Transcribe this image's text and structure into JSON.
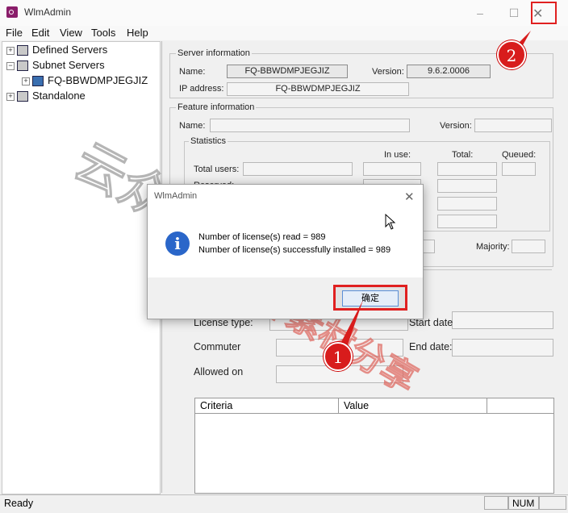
{
  "window": {
    "title": "WlmAdmin",
    "minimize_glyph": "–",
    "maximize_glyph": "☐",
    "close_glyph": "✕"
  },
  "menu": [
    "File",
    "Edit",
    "View",
    "Tools",
    "Help"
  ],
  "tree": {
    "defined_servers": "Defined Servers",
    "subnet_servers": "Subnet Servers",
    "server_node": "FQ-BBWDMPJEGJIZ",
    "standalone": "Standalone"
  },
  "server_info": {
    "group_label": "Server information",
    "name_label": "Name:",
    "name_value": "FQ-BBWDMPJEGJIZ",
    "version_label": "Version:",
    "version_value": "9.6.2.0006",
    "ip_label": "IP address:",
    "ip_value": "FQ-BBWDMPJEGJIZ"
  },
  "feature_info": {
    "group_label": "Feature information",
    "name_label": "Name:",
    "version_label": "Version:",
    "statistics_label": "Statistics",
    "in_use_label": "In use:",
    "total_label": "Total:",
    "queued_label": "Queued:",
    "total_users_label": "Total users:",
    "reserved_label": "Reserved:",
    "majority_label": "Majority:"
  },
  "license": {
    "license_type_label": "License type:",
    "start_date_label": "Start date",
    "commuter_label": "Commuter",
    "end_date_label": "End date:",
    "allowed_on_label": "Allowed on",
    "columns": [
      "Criteria",
      "Value"
    ]
  },
  "dialog": {
    "title": "WlmAdmin",
    "close_glyph": "✕",
    "info_glyph": "i",
    "line1": "Number of license(s) read = 989",
    "line2": "Number of license(s) successfully installed = 989",
    "ok_label": "确定"
  },
  "status": {
    "text": "Ready",
    "num": "NUM"
  },
  "annotations": {
    "step1": "1",
    "step2": "2",
    "color": "#d81c1c"
  },
  "watermark": {
    "left": "云众.",
    "right": "设计素材分享"
  }
}
